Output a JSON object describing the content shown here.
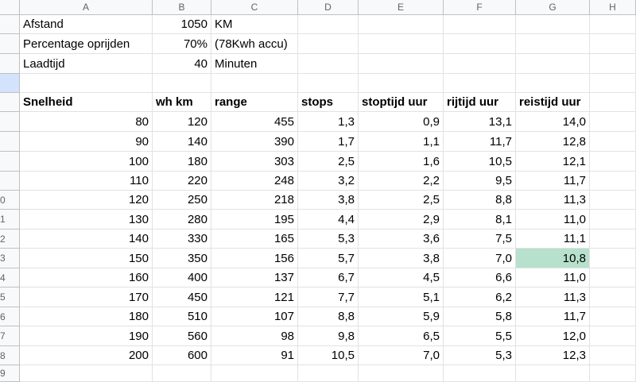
{
  "columns": [
    "A",
    "B",
    "C",
    "D",
    "E",
    "F",
    "G",
    "H"
  ],
  "row_numbers": [
    "",
    "",
    "",
    "",
    "",
    "",
    "",
    "",
    "",
    "0",
    "1",
    "2",
    "3",
    "4",
    "5",
    "6",
    "7",
    "8",
    "9"
  ],
  "params": [
    {
      "label": "Afstand",
      "value": "1050",
      "unit": "KM"
    },
    {
      "label": "Percentage oprijden",
      "value": "70%",
      "unit": "(78Kwh accu)"
    },
    {
      "label": "Laadtijd",
      "value": "40",
      "unit": "Minuten"
    }
  ],
  "table": {
    "headers": [
      "Snelheid",
      "wh km",
      "range",
      "stops",
      "stoptijd uur",
      "rijtijd uur",
      "reistijd uur"
    ],
    "rows": [
      [
        "80",
        "120",
        "455",
        "1,3",
        "0,9",
        "13,1",
        "14,0"
      ],
      [
        "90",
        "140",
        "390",
        "1,7",
        "1,1",
        "11,7",
        "12,8"
      ],
      [
        "100",
        "180",
        "303",
        "2,5",
        "1,6",
        "10,5",
        "12,1"
      ],
      [
        "110",
        "220",
        "248",
        "3,2",
        "2,2",
        "9,5",
        "11,7"
      ],
      [
        "120",
        "250",
        "218",
        "3,8",
        "2,5",
        "8,8",
        "11,3"
      ],
      [
        "130",
        "280",
        "195",
        "4,4",
        "2,9",
        "8,1",
        "11,0"
      ],
      [
        "140",
        "330",
        "165",
        "5,3",
        "3,6",
        "7,5",
        "11,1"
      ],
      [
        "150",
        "350",
        "156",
        "5,7",
        "3,8",
        "7,0",
        "10,8"
      ],
      [
        "160",
        "400",
        "137",
        "6,7",
        "4,5",
        "6,6",
        "11,0"
      ],
      [
        "170",
        "450",
        "121",
        "7,7",
        "5,1",
        "6,2",
        "11,3"
      ],
      [
        "180",
        "510",
        "107",
        "8,8",
        "5,9",
        "5,8",
        "11,7"
      ],
      [
        "190",
        "560",
        "98",
        "9,8",
        "6,5",
        "5,5",
        "12,0"
      ],
      [
        "200",
        "600",
        "91",
        "10,5",
        "7,0",
        "5,3",
        "12,3"
      ]
    ],
    "highlighted_cell": {
      "row": 7,
      "col": 6
    },
    "highlight_color": "#b7e1cd"
  }
}
